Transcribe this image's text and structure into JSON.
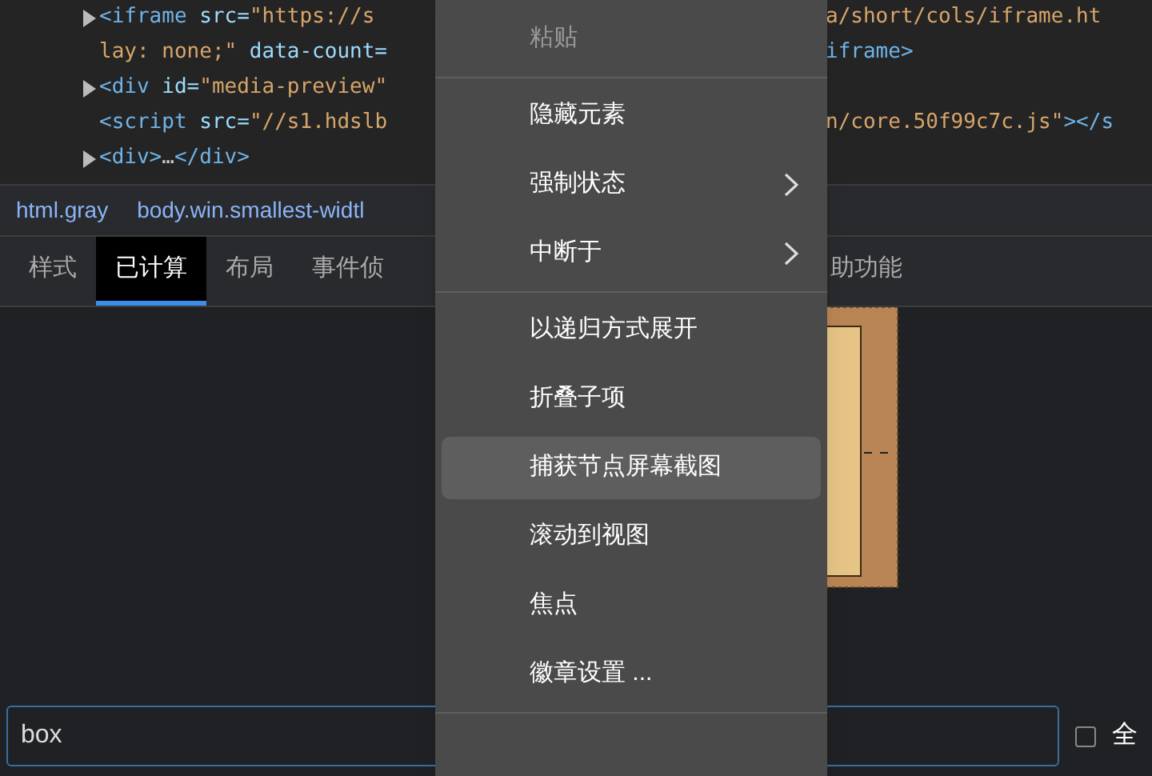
{
  "code_lines": [
    {
      "expandable": true,
      "left": [
        {
          "kind": "tag",
          "text": "<iframe"
        },
        {
          "kind": "attr",
          "text": " src="
        },
        {
          "kind": "value",
          "text": "\"https://s"
        }
      ],
      "right": [
        {
          "kind": "value",
          "text": "a/short/cols/iframe.ht"
        }
      ]
    },
    {
      "expandable": false,
      "left": [
        {
          "kind": "value",
          "text": "lay: none;\""
        },
        {
          "kind": "attr",
          "text": " data-count="
        }
      ],
      "right": [
        {
          "kind": "tag",
          "text": "iframe>"
        }
      ]
    },
    {
      "expandable": true,
      "left": [
        {
          "kind": "tag",
          "text": "<div"
        },
        {
          "kind": "attr",
          "text": " id="
        },
        {
          "kind": "value",
          "text": "\"media-preview\""
        }
      ]
    },
    {
      "expandable": false,
      "left": [
        {
          "kind": "tag",
          "text": "<script"
        },
        {
          "kind": "attr",
          "text": " src="
        },
        {
          "kind": "value",
          "text": "\"//s1.hdslb"
        }
      ],
      "right": [
        {
          "kind": "value",
          "text": "n/core.50f99c7c.js\""
        },
        {
          "kind": "tag",
          "text": "></s"
        }
      ]
    },
    {
      "expandable": true,
      "left": [
        {
          "kind": "tag",
          "text": "<div>"
        },
        {
          "kind": "text",
          "text": "…"
        },
        {
          "kind": "tag",
          "text": "</div>"
        }
      ]
    }
  ],
  "breadcrumbs": [
    {
      "label": "html.gray"
    },
    {
      "label": "body.win.smallest-widtl"
    }
  ],
  "tabs": [
    {
      "label": "样式",
      "selected": false
    },
    {
      "label": "已计算",
      "selected": true
    },
    {
      "label": "布局",
      "selected": false
    },
    {
      "label": "事件侦",
      "selected": false
    },
    {
      "label": "助功能",
      "selected": false
    }
  ],
  "filter": {
    "value": "box"
  },
  "filter_option": {
    "label": "全",
    "checked": false
  },
  "context_menu": [
    {
      "kind": "item",
      "label": "粘贴",
      "disabled": true,
      "submenu": false,
      "selected": false
    },
    {
      "kind": "separator"
    },
    {
      "kind": "item",
      "label": "隐藏元素",
      "disabled": false,
      "submenu": false,
      "selected": false
    },
    {
      "kind": "item",
      "label": "强制状态",
      "disabled": false,
      "submenu": true,
      "selected": false
    },
    {
      "kind": "item",
      "label": "中断于",
      "disabled": false,
      "submenu": true,
      "selected": false
    },
    {
      "kind": "separator"
    },
    {
      "kind": "item",
      "label": "以递归方式展开",
      "disabled": false,
      "submenu": false,
      "selected": false
    },
    {
      "kind": "item",
      "label": "折叠子项",
      "disabled": false,
      "submenu": false,
      "selected": false
    },
    {
      "kind": "item",
      "label": "捕获节点屏幕截图",
      "disabled": false,
      "submenu": false,
      "selected": true
    },
    {
      "kind": "item",
      "label": "滚动到视图",
      "disabled": false,
      "submenu": false,
      "selected": false
    },
    {
      "kind": "item",
      "label": "焦点",
      "disabled": false,
      "submenu": false,
      "selected": false
    },
    {
      "kind": "item",
      "label": "徽章设置 ...",
      "disabled": false,
      "submenu": false,
      "selected": false
    },
    {
      "kind": "separator"
    }
  ]
}
